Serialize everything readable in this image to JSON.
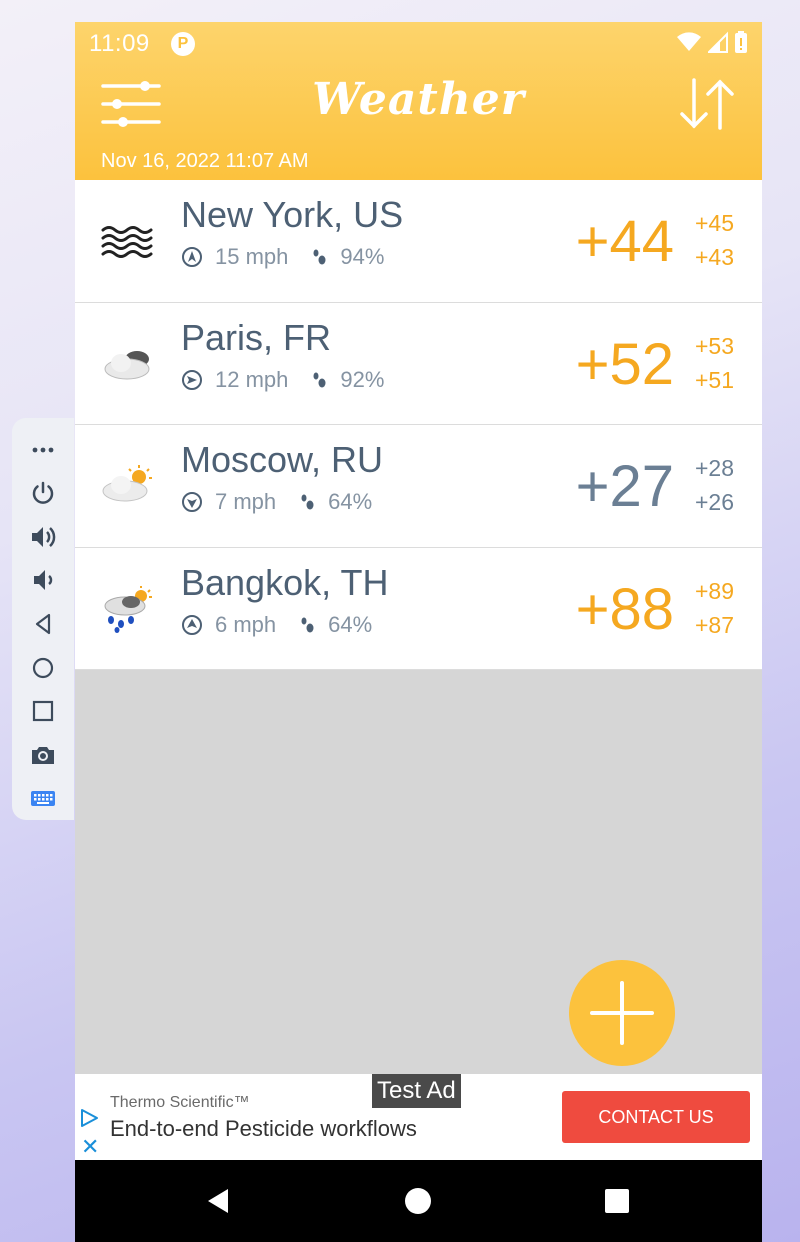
{
  "status_bar": {
    "time": "11:09",
    "app_icon_letter": "P"
  },
  "header": {
    "title": "Weather",
    "updated": "Nov 16, 2022 11:07 AM"
  },
  "cities": [
    {
      "name": "New York, US",
      "wind": "15 mph",
      "humidity": "94%",
      "temp": "+44",
      "high": "+45",
      "low": "+43",
      "condition": "fog-icon",
      "tone": "warm"
    },
    {
      "name": "Paris, FR",
      "wind": "12 mph",
      "humidity": "92%",
      "temp": "+52",
      "high": "+53",
      "low": "+51",
      "condition": "cloudy-icon",
      "tone": "warm"
    },
    {
      "name": "Moscow, RU",
      "wind": "7 mph",
      "humidity": "64%",
      "temp": "+27",
      "high": "+28",
      "low": "+26",
      "condition": "partly-sunny-icon",
      "tone": "cool"
    },
    {
      "name": "Bangkok, TH",
      "wind": "6 mph",
      "humidity": "64%",
      "temp": "+88",
      "high": "+89",
      "low": "+87",
      "condition": "rain-sun-icon",
      "tone": "warm"
    }
  ],
  "ad": {
    "label": "Test Ad",
    "brand": "Thermo Scientific™",
    "text": "End-to-end Pesticide workflows",
    "cta": "CONTACT US",
    "close": "✕"
  },
  "colors": {
    "accent": "#fcc23d",
    "warm_temp": "#f5a820",
    "cool_temp": "#6b7f94",
    "cta": "#ef4b3f"
  }
}
